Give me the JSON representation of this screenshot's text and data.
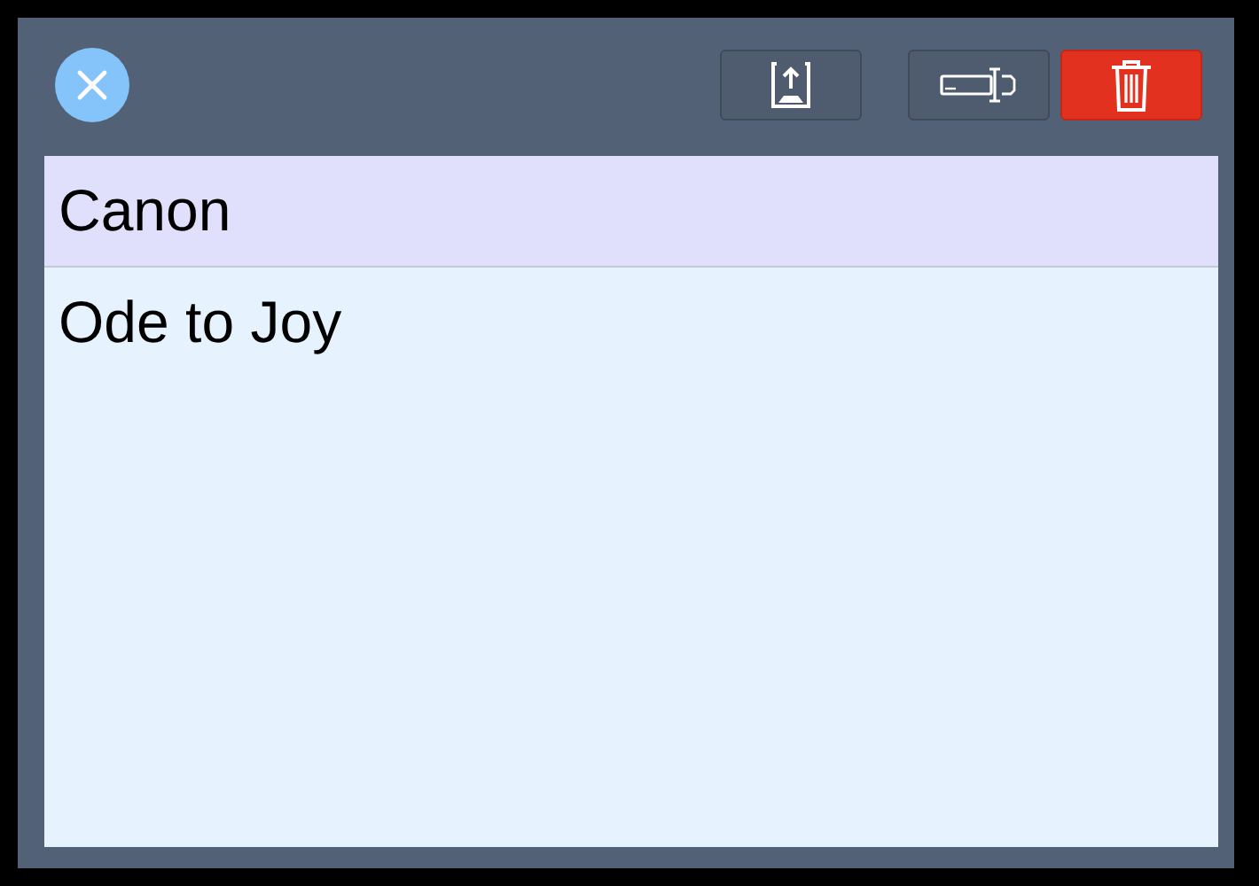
{
  "items": [
    {
      "label": "Canon",
      "selected": true
    },
    {
      "label": "Ode to Joy",
      "selected": false
    }
  ]
}
